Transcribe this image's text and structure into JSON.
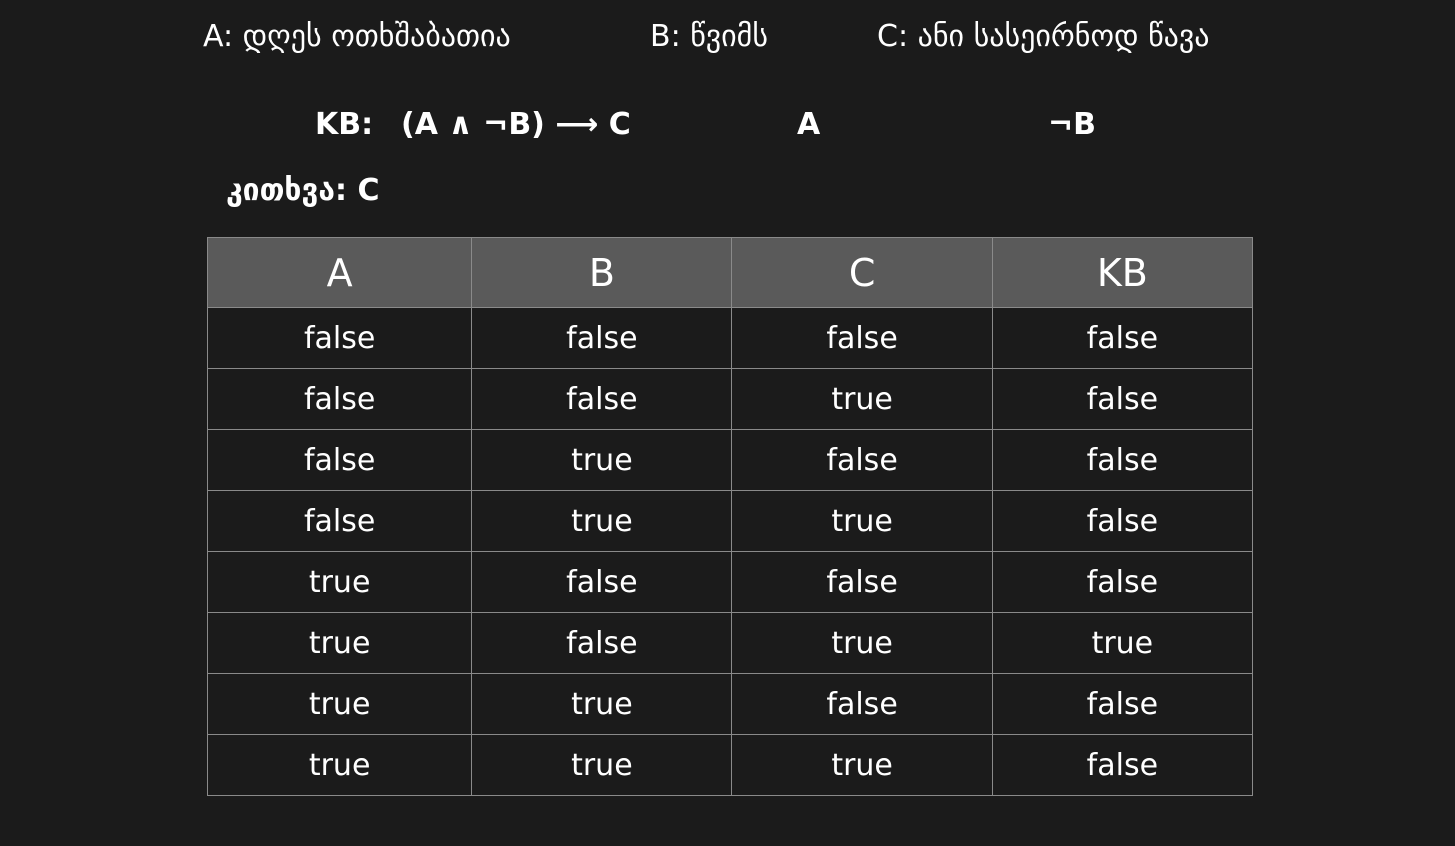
{
  "propositions": {
    "a": "A: დღეს ოთხშაბათია",
    "b": "B: წვიმს",
    "c": "C: ანი სასეირნოდ წავა"
  },
  "kb": {
    "label": "KB:",
    "formula": "(A ∧ ¬B) ⟶ C",
    "fact1": "A",
    "fact2": "¬B"
  },
  "query": "კითხვა: C",
  "table": {
    "headers": [
      "A",
      "B",
      "C",
      "KB"
    ],
    "rows": [
      [
        "false",
        "false",
        "false",
        "false"
      ],
      [
        "false",
        "false",
        "true",
        "false"
      ],
      [
        "false",
        "true",
        "false",
        "false"
      ],
      [
        "false",
        "true",
        "true",
        "false"
      ],
      [
        "true",
        "false",
        "false",
        "false"
      ],
      [
        "true",
        "false",
        "true",
        "true"
      ],
      [
        "true",
        "true",
        "false",
        "false"
      ],
      [
        "true",
        "true",
        "true",
        "false"
      ]
    ]
  },
  "colors": {
    "background": "#1b1b1b",
    "header_background": "#5a5a5a",
    "border": "#8a8a8a",
    "text": "#ffffff"
  }
}
